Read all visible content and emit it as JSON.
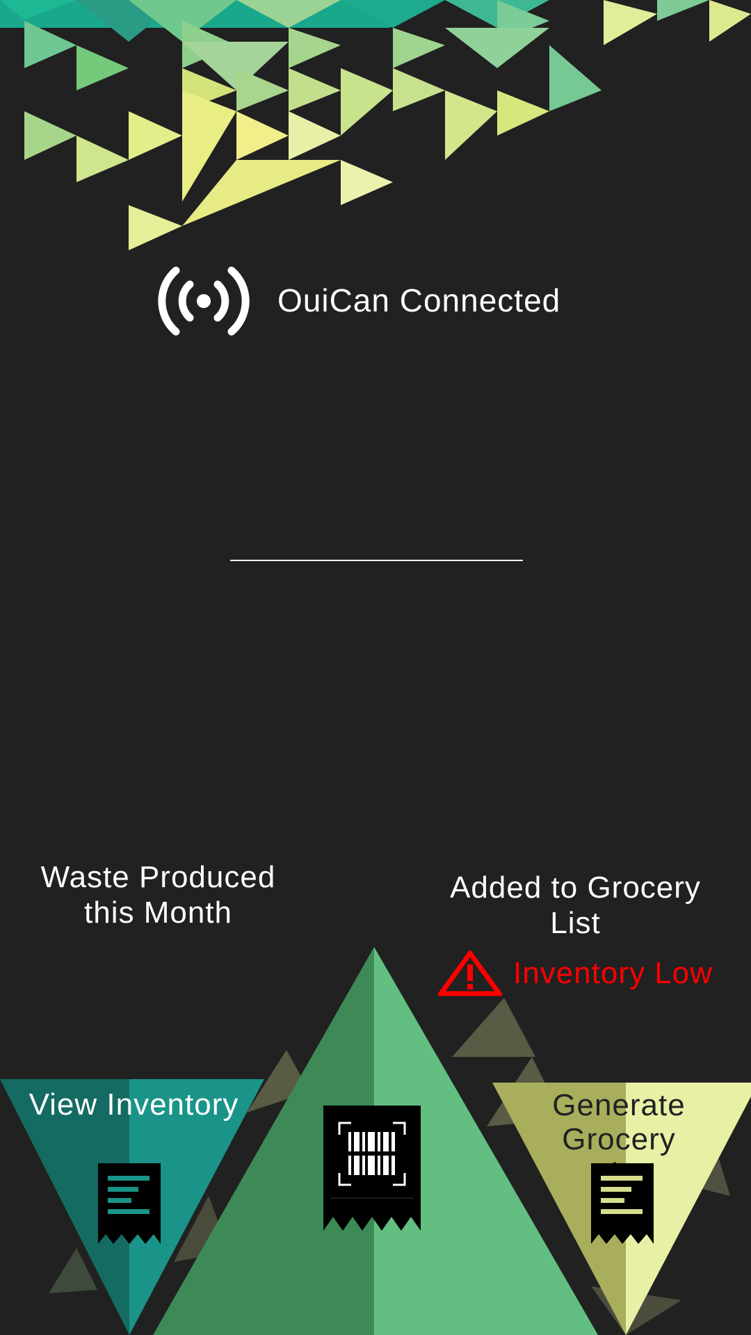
{
  "status": {
    "connection_label": "OuiCan Connected",
    "icon": "broadcast-icon"
  },
  "stats": {
    "waste_label": "Waste Produced this Month",
    "grocery_label": "Added to Grocery List",
    "alert_label": "Inventory Low",
    "alert_icon": "warning-icon",
    "alert_color": "#ff0000"
  },
  "actions": {
    "view_inventory_label": "View Inventory",
    "view_inventory_icon": "receipt-icon",
    "scan_icon": "barcode-scan-icon",
    "generate_list_label": "Generate Grocery List",
    "generate_list_icon": "receipt-icon"
  },
  "colors": {
    "background": "#212121",
    "teal": "#1a9488",
    "green": "#62bf81",
    "lime": "#e7f0a5"
  }
}
